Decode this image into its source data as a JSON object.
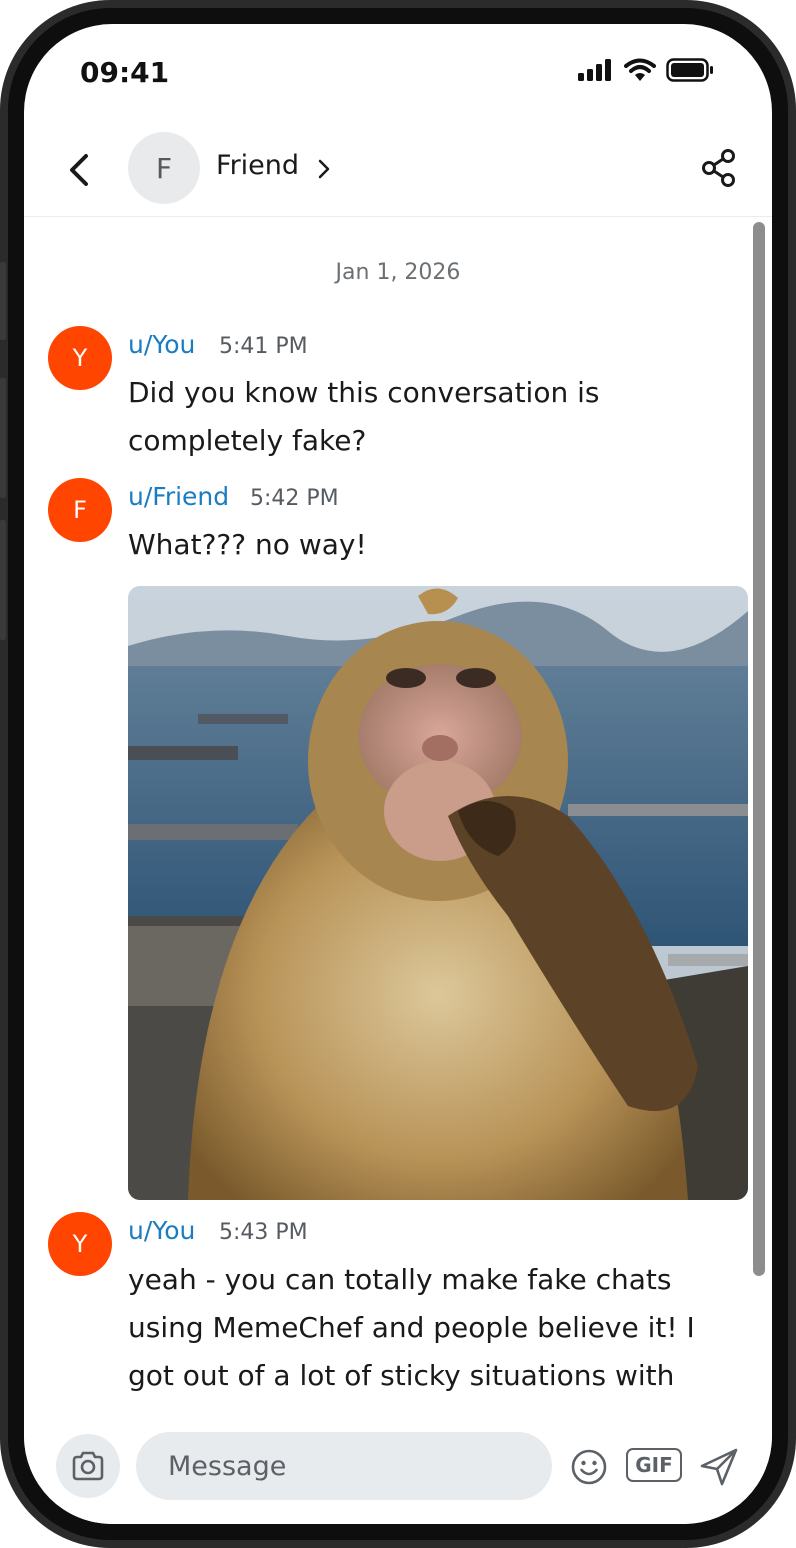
{
  "status": {
    "time": "09:41"
  },
  "header": {
    "avatar_letter": "F",
    "name": "Friend"
  },
  "date_separator": "Jan 1, 2026",
  "messages": [
    {
      "avatar_letter": "Y",
      "user": "u/You",
      "time": "5:41 PM",
      "text": "Did you know this conversation is completely fake?"
    },
    {
      "avatar_letter": "F",
      "user": "u/Friend",
      "time": "5:42 PM",
      "text": "What??? no way!"
    },
    {
      "avatar_letter": "Y",
      "user": "u/You",
      "time": "5:43 PM",
      "text": "yeah - you can totally make fake chats using MemeChef and people believe it! I got out of a lot of sticky situations with"
    }
  ],
  "composer": {
    "placeholder": "Message",
    "gif_label": "GIF"
  },
  "colors": {
    "avatar": "#ff4500",
    "username": "#1a7cc1",
    "bubble_bg": "#e8ebee"
  }
}
